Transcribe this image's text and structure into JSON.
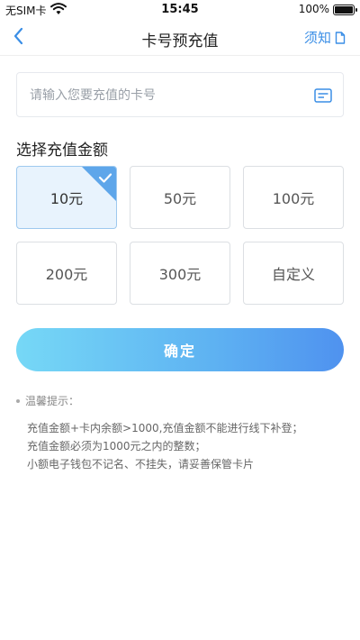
{
  "status_bar": {
    "carrier": "无SIM卡",
    "time": "15:45",
    "battery_percent": "100%"
  },
  "nav": {
    "title": "卡号预充值",
    "notice_label": "须知"
  },
  "card_input": {
    "placeholder": "请输入您要充值的卡号",
    "value": ""
  },
  "amount_section": {
    "title": "选择充值金额",
    "options": [
      {
        "label": "10元",
        "selected": true
      },
      {
        "label": "50元",
        "selected": false
      },
      {
        "label": "100元",
        "selected": false
      },
      {
        "label": "200元",
        "selected": false
      },
      {
        "label": "300元",
        "selected": false
      },
      {
        "label": "自定义",
        "selected": false
      }
    ]
  },
  "confirm_label": "确定",
  "tips": {
    "title": "温馨提示：",
    "lines": [
      "充值金额+卡内余额>1000,充值金额不能进行线下补登；",
      "充值金额必须为1000元之内的整数；",
      "小额电子钱包不记名、不挂失，请妥善保管卡片"
    ]
  },
  "colors": {
    "accent": "#3a8ee6",
    "selected_bg": "#e8f3fd",
    "button_gradient_start": "#76d8f6",
    "button_gradient_end": "#4f92ef"
  }
}
